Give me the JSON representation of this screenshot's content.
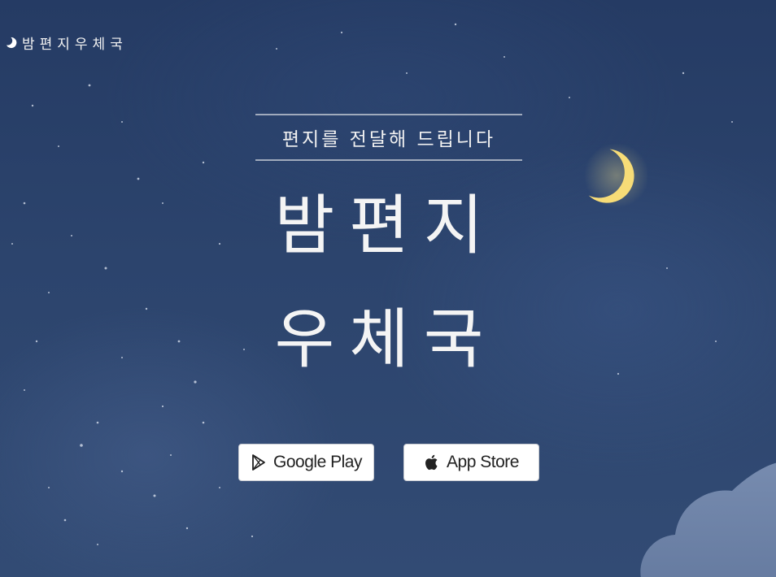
{
  "brand": {
    "icon": "crescent-moon-icon",
    "text": "밤편지우체국"
  },
  "hero": {
    "subtitle": "편지를 전달해 드립니다",
    "title_line1": "밤편지",
    "title_line2": "우체국"
  },
  "store_buttons": {
    "google_play": {
      "label": "Google Play",
      "icon": "google-play-icon"
    },
    "app_store": {
      "label": "App Store",
      "icon": "apple-icon"
    }
  },
  "colors": {
    "background": "#2c446d",
    "moon": "#f7dc77",
    "text": "#f2f2f2",
    "button_bg": "#ffffff"
  }
}
